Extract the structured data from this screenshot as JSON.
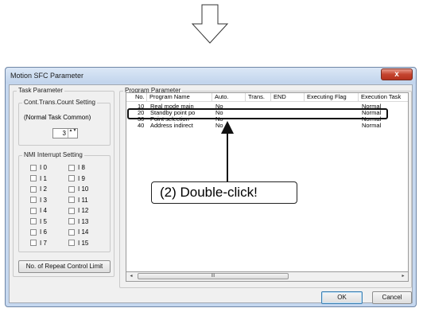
{
  "window": {
    "title": "Motion SFC Parameter",
    "close_glyph": "x"
  },
  "task_parameter": {
    "group_label": "Task Parameter",
    "cont_trans": {
      "group_label": "Cont.Trans.Count Setting",
      "subtitle": "(Normal Task Common)",
      "value": "3",
      "arrows": "▲▼"
    },
    "nmi": {
      "group_label": "NMI Interrupt Setting",
      "left": [
        "I 0",
        "I 1",
        "I 2",
        "I 3",
        "I 4",
        "I 5",
        "I 6",
        "I 7"
      ],
      "right": [
        "I 8",
        "I 9",
        "I 10",
        "I 11",
        "I 12",
        "I 13",
        "I 14",
        "I 15"
      ]
    },
    "repeat_button": "No. of Repeat Control Limit"
  },
  "program_parameter": {
    "group_label": "Program Parameter",
    "columns": [
      "No.",
      "Program Name",
      "Auto.",
      "Trans.",
      "END",
      "Executing Flag",
      "Execution Task"
    ],
    "rows": [
      {
        "no": "10",
        "name": "Real mode main",
        "auto": "No",
        "task": "Normal"
      },
      {
        "no": "20",
        "name": "Standby point po",
        "auto": "No",
        "task": "Normal"
      },
      {
        "no": "30",
        "name": "Point selection",
        "auto": "No",
        "task": "Normal"
      },
      {
        "no": "40",
        "name": "Address indirect",
        "auto": "No",
        "task": "Normal"
      }
    ],
    "scroll_left": "◂",
    "scroll_right": "▸",
    "scroll_grip": "III"
  },
  "buttons": {
    "ok": "OK",
    "cancel": "Cancel"
  },
  "annotation": {
    "callout": "(2) Double-click!"
  },
  "icons": {
    "top": "down-arrow-icon",
    "pointer": "up-arrow-icon"
  }
}
